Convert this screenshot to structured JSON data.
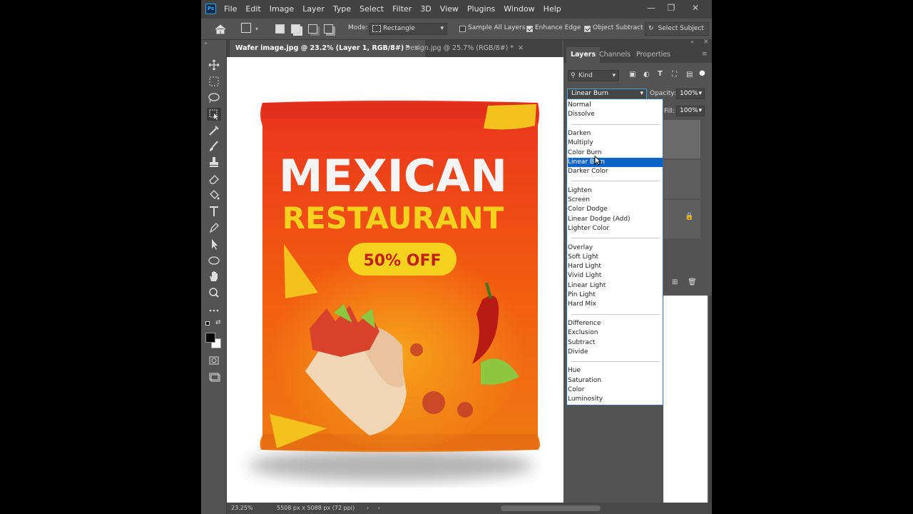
{
  "app": {
    "name": "Photoshop",
    "logo_text": "Ps"
  },
  "menu": [
    "File",
    "Edit",
    "Image",
    "Layer",
    "Type",
    "Select",
    "Filter",
    "3D",
    "View",
    "Plugins",
    "Window",
    "Help"
  ],
  "options": {
    "mode_label": "Mode:",
    "mode_value": "Rectangle",
    "sample_all_layers": {
      "label": "Sample All Layers",
      "checked": false
    },
    "enhance_edge": {
      "label": "Enhance Edge",
      "checked": true
    },
    "object_subtract": {
      "label": "Object Subtract",
      "checked": true
    },
    "select_subject": "Select Subject"
  },
  "document_tabs": [
    {
      "label": "Wafer image.jpg @ 23.2% (Layer 1, RGB/8#) *",
      "active": true
    },
    {
      "label": "Design.jpg @ 25.7% (RGB/8#) *",
      "active": false
    }
  ],
  "artwork": {
    "title_line1": "MEXICAN",
    "title_line2": "RESTAURANT",
    "badge": "50% OFF",
    "colors": {
      "bag_top": "#e9321f",
      "bag_mid": "#f25a10",
      "bag_bottom": "#f07a12",
      "title": "#f5f5f5",
      "subtitle": "#f6d21e",
      "badge_bg": "#f6d21e",
      "badge_text": "#c42010"
    }
  },
  "status": {
    "zoom": "23.25%",
    "doc_size": "5508 px x 5088 px (72 ppi)"
  },
  "panel": {
    "tabs": [
      "Layers",
      "Channels",
      "Properties"
    ],
    "kind_label": "Kind",
    "blend_mode": "Linear Burn",
    "opacity_label": "Opacity:",
    "opacity_value": "100%",
    "fill_label": "Fill:",
    "fill_value": "100%"
  },
  "blend_modes": {
    "groups": [
      [
        "Normal",
        "Dissolve"
      ],
      [
        "Darken",
        "Multiply",
        "Color Burn",
        "Linear Burn",
        "Darker Color"
      ],
      [
        "Lighten",
        "Screen",
        "Color Dodge",
        "Linear Dodge (Add)",
        "Lighter Color"
      ],
      [
        "Overlay",
        "Soft Light",
        "Hard Light",
        "Vivid Light",
        "Linear Light",
        "Pin Light",
        "Hard Mix"
      ],
      [
        "Difference",
        "Exclusion",
        "Subtract",
        "Divide"
      ],
      [
        "Hue",
        "Saturation",
        "Color",
        "Luminosity"
      ]
    ],
    "highlighted": "Linear Burn"
  },
  "accent": "#31a8ff",
  "highlight_color": "#0a64c8"
}
